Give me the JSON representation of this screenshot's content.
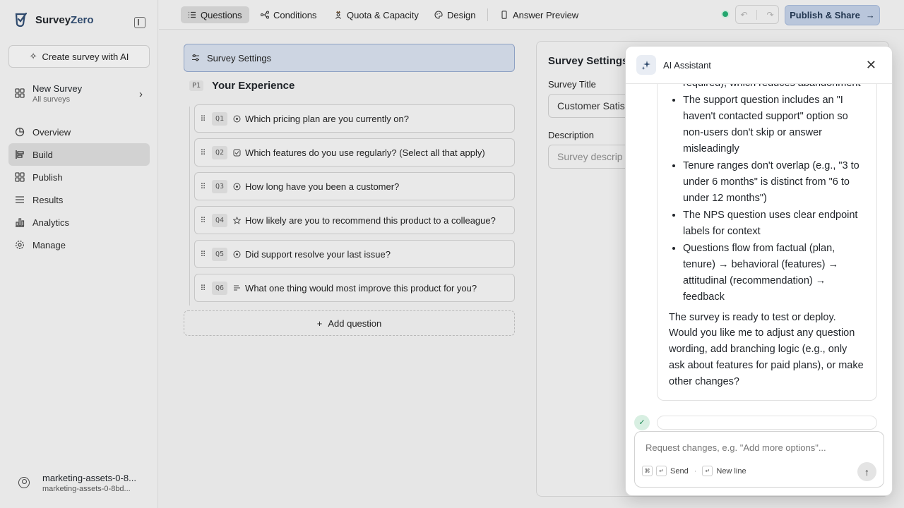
{
  "app": {
    "name_main": "Survey",
    "name_accent": "Zero"
  },
  "sidebar": {
    "create_ai_label": "Create survey with AI",
    "survey": {
      "name": "New Survey",
      "sub": "All surveys"
    },
    "nav": [
      {
        "label": "Overview",
        "icon": "pie-chart-icon"
      },
      {
        "label": "Build",
        "icon": "build-icon",
        "active": true
      },
      {
        "label": "Publish",
        "icon": "grid-icon"
      },
      {
        "label": "Results",
        "icon": "list-icon"
      },
      {
        "label": "Analytics",
        "icon": "bar-chart-icon"
      },
      {
        "label": "Manage",
        "icon": "gear-icon"
      }
    ],
    "user": {
      "name": "marketing-assets-0-8...",
      "email": "marketing-assets-0-8bd..."
    }
  },
  "topbar": {
    "tabs": [
      {
        "label": "Questions",
        "active": true
      },
      {
        "label": "Conditions"
      },
      {
        "label": "Quota & Capacity"
      },
      {
        "label": "Design"
      },
      {
        "label": "Answer Preview"
      }
    ],
    "publish_label": "Publish & Share",
    "status_color": "#22a66e"
  },
  "builder": {
    "settings_row_label": "Survey Settings",
    "page_badge": "P1",
    "page_title": "Your Experience",
    "questions": [
      {
        "num": "Q1",
        "type_icon": "radio-icon",
        "text": "Which pricing plan are you currently on?"
      },
      {
        "num": "Q2",
        "type_icon": "checkbox-icon",
        "text": "Which features do you use regularly? (Select all that apply)"
      },
      {
        "num": "Q3",
        "type_icon": "radio-icon",
        "text": "How long have you been a customer?"
      },
      {
        "num": "Q4",
        "type_icon": "star-icon",
        "text": "How likely are you to recommend this product to a colleague?"
      },
      {
        "num": "Q5",
        "type_icon": "radio-icon",
        "text": "Did support resolve your last issue?"
      },
      {
        "num": "Q6",
        "type_icon": "text-lines-icon",
        "text": "What one thing would most improve this product for you?"
      }
    ],
    "add_question_label": "Add question"
  },
  "settings_panel": {
    "title": "Survey Settings",
    "title_label": "Survey Title",
    "title_value": "Customer Satis",
    "description_label": "Description",
    "description_placeholder": "Survey descrip"
  },
  "assistant": {
    "title": "AI Assistant",
    "message": {
      "bullets": [
        "required), which reduces abandonment",
        "The support question includes an \"I haven't contacted support\" option so non-users don't skip or answer misleadingly",
        "Tenure ranges don't overlap (e.g., \"3 to under 6 months\" is distinct from \"6 to under 12 months\")",
        "The NPS question uses clear endpoint labels for context",
        "Questions flow from factual (plan, tenure) → behavioral (features) → attitudinal (recommendation) → feedback"
      ],
      "closing": "The survey is ready to test or deploy. Would you like me to adjust any question wording, add branching logic (e.g., only ask about features for paid plans), or make other changes?"
    },
    "input_placeholder": "Request changes, e.g. \"Add more options\"...",
    "hint_send": "Send",
    "hint_newline": "New line"
  }
}
